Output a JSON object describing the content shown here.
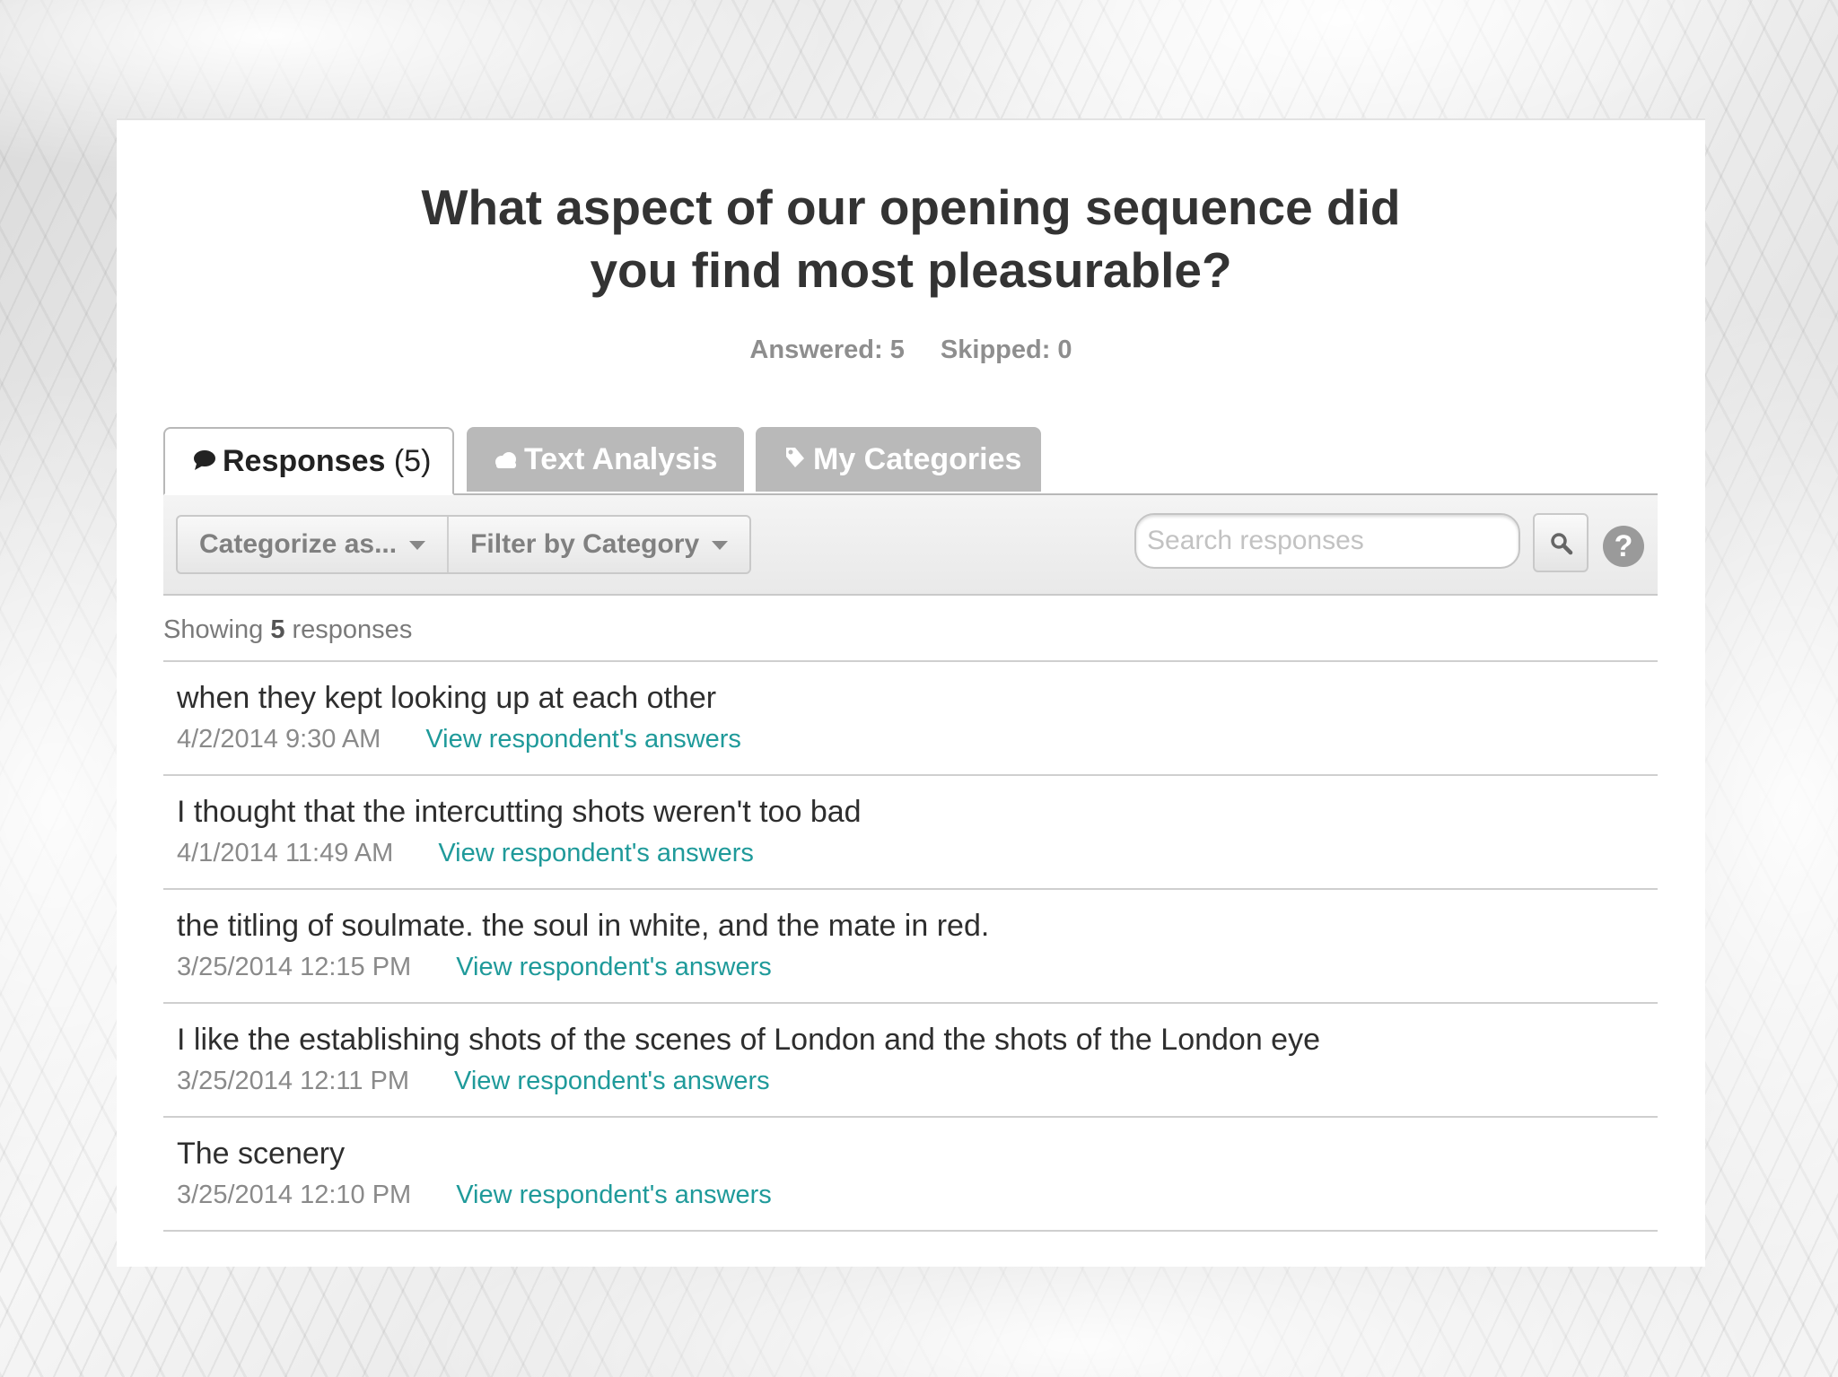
{
  "question": {
    "title_line1": "What aspect of our opening sequence did",
    "title_line2": "you find most pleasurable?",
    "answered": "Answered: 5",
    "skipped": "Skipped: 0"
  },
  "tabs": [
    {
      "label": "Responses",
      "count": "(5)",
      "icon": "speech-bubble-icon"
    },
    {
      "label": "Text Analysis",
      "icon": "cloud-icon"
    },
    {
      "label": "My Categories",
      "icon": "tag-icon"
    }
  ],
  "toolbar": {
    "categorize_label": "Categorize as...",
    "filter_label": "Filter by Category",
    "search_placeholder": "Search responses",
    "help_label": "?"
  },
  "showing": {
    "prefix": "Showing",
    "count": "5",
    "suffix": "responses"
  },
  "responses": [
    {
      "text": "when they kept looking up at each other",
      "date": "4/2/2014 9:30 AM",
      "link": "View respondent's answers"
    },
    {
      "text": "I thought that the intercutting shots weren't too bad",
      "date": "4/1/2014 11:49 AM",
      "link": "View respondent's answers"
    },
    {
      "text": "the titling of soulmate. the soul in white, and the mate in red.",
      "date": "3/25/2014 12:15 PM",
      "link": "View respondent's answers"
    },
    {
      "text": "I like the establishing shots of the scenes of London and the shots of the London eye",
      "date": "3/25/2014 12:11 PM",
      "link": "View respondent's answers"
    },
    {
      "text": "The scenery",
      "date": "3/25/2014 12:10 PM",
      "link": "View respondent's answers"
    }
  ],
  "colors": {
    "link": "#1f9a9a",
    "inactive_tab": "#b9b9b9",
    "title": "#333333"
  }
}
